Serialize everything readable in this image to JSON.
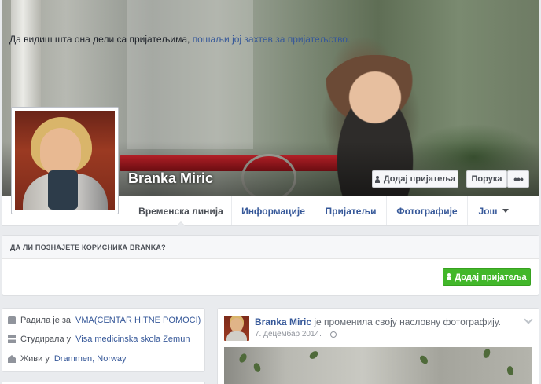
{
  "profile": {
    "name": "Branka Miric"
  },
  "cover_buttons": {
    "add_friend": "Додај пријатеља",
    "message": "Порука",
    "more": "•••"
  },
  "nav": {
    "tabs": [
      {
        "label": "Временска линија"
      },
      {
        "label": "Информације"
      },
      {
        "label": "Пријатељи"
      },
      {
        "label": "Фотографије"
      },
      {
        "label": "Још"
      }
    ]
  },
  "know_box": {
    "title": "ДА ЛИ ПОЗНАЈЕТЕ КОРИСНИКА BRANKA?",
    "text": "Да видиш шта она дели са пријатељима,",
    "link": "пошаљи јој захтев за пријатељство.",
    "button": "Додај пријатеља"
  },
  "intro": {
    "rows": [
      {
        "prefix": "Радила је за",
        "link": "VMA(CENTAR HITNE POMOCI)",
        "icon": "briefcase-icon"
      },
      {
        "prefix": "Студирала у",
        "link": "Visa medicinska skola Zemun",
        "icon": "graduation-cap-icon"
      },
      {
        "prefix": "Живи у",
        "link": "Drammen, Norway",
        "icon": "home-icon"
      }
    ]
  },
  "post": {
    "author": "Branka Miric",
    "action": "је променила своју насловну фотографију.",
    "date": "7. децембар 2014."
  },
  "colors": {
    "link": "#365899",
    "green_button": "#42b72a",
    "background": "#e9ebee"
  }
}
